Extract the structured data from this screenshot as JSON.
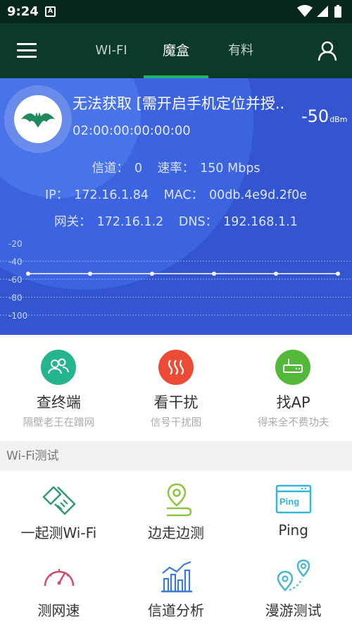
{
  "status_bar": {
    "time": "9:24",
    "notification_icon": "A"
  },
  "header": {
    "tabs": [
      {
        "label": "WI-FI",
        "active": false
      },
      {
        "label": "魔盒",
        "active": true
      },
      {
        "label": "有料",
        "active": false
      }
    ],
    "icons": [
      "menu-icon",
      "user-icon"
    ]
  },
  "wifi_info": {
    "ssid": "无法获取 [需开启手机定位并授..",
    "bssid": "02:00:00:00:00:00",
    "signal_value": "-50",
    "signal_unit": "dBm",
    "channel_label": "信道：",
    "channel": "0",
    "rate_label": "速率：",
    "rate": "150 Mbps",
    "ip_label": "IP：",
    "ip": "172.16.1.84",
    "mac_label": "MAC：",
    "mac": "00db.4e9d.2f0e",
    "gateway_label": "网关：",
    "gateway": "172.16.1.2",
    "dns_label": "DNS：",
    "dns": "192.168.1.1"
  },
  "chart_data": {
    "type": "line",
    "y_ticks": [
      "-20",
      "-40",
      "-60",
      "-80",
      "-100"
    ],
    "ylim": [
      -100,
      -20
    ],
    "grid": true,
    "x": [
      0,
      1,
      2,
      3,
      4,
      5
    ],
    "series": [
      {
        "values": [
          -50,
          -50,
          -50,
          -50,
          -50,
          -50
        ]
      }
    ],
    "colors": {
      "line": "#ffffff",
      "grid": "#8fa6ef",
      "label": "#c9d5ff"
    }
  },
  "features": [
    {
      "title": "查终端",
      "subtitle": "隔壁老王在蹭网",
      "icon": "users-icon",
      "color": "#24b58f"
    },
    {
      "title": "看干扰",
      "subtitle": "信号干扰图",
      "icon": "interference-icon",
      "color": "#ec4b36"
    },
    {
      "title": "找AP",
      "subtitle": "得来全不费功夫",
      "icon": "router-icon",
      "color": "#54b83a"
    }
  ],
  "section": {
    "title": "Wi-Fi测试"
  },
  "tools": [
    {
      "label": "一起测Wi-Fi",
      "icon": "handshake-icon",
      "color": "#2e9c6e"
    },
    {
      "label": "边走边测",
      "icon": "location-walk-icon",
      "color": "#8cc63f"
    },
    {
      "label": "Ping",
      "icon": "ping-window-icon",
      "color": "#33b7d9"
    },
    {
      "label": "测网速",
      "icon": "speedometer-icon",
      "color": "#d9486b"
    },
    {
      "label": "信道分析",
      "icon": "bar-chart-icon",
      "color": "#3d7bd6"
    },
    {
      "label": "漫游测试",
      "icon": "roaming-pins-icon",
      "color": "#44b8c8"
    }
  ]
}
